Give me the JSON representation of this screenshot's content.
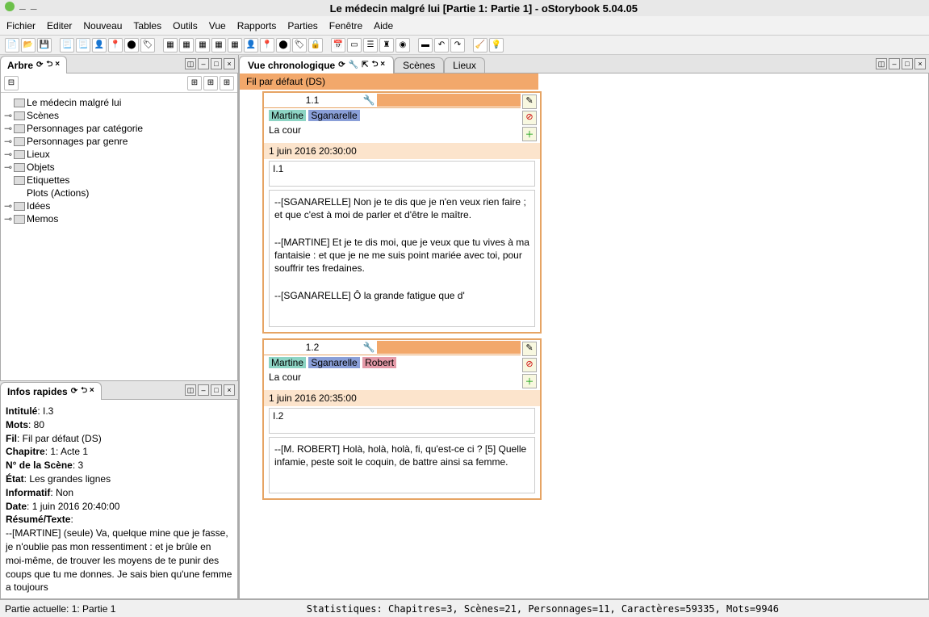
{
  "window": {
    "title": "Le médecin malgré lui [Partie 1: Partie 1] - oStorybook 5.04.05"
  },
  "menu": {
    "fichier": "Fichier",
    "editer": "Editer",
    "nouveau": "Nouveau",
    "tables": "Tables",
    "outils": "Outils",
    "vue": "Vue",
    "rapports": "Rapports",
    "parties": "Parties",
    "fenetre": "Fenêtre",
    "aide": "Aide"
  },
  "tree_panel": {
    "title": "Arbre",
    "root": "Le médecin malgré lui",
    "items": [
      "Scènes",
      "Personnages par catégorie",
      "Personnages par genre",
      "Lieux",
      "Objets",
      "Etiquettes",
      "Plots (Actions)",
      "Idées",
      "Memos"
    ]
  },
  "info_panel": {
    "title": "Infos rapides",
    "intitule_label": "Intitulé",
    "intitule": "I.3",
    "mots_label": "Mots",
    "mots": "80",
    "fil_label": "Fil",
    "fil": "Fil par défaut (DS)",
    "chapitre_label": "Chapitre",
    "chapitre": "1: Acte 1",
    "num_label": "N° de la Scène",
    "num": "3",
    "etat_label": "État",
    "etat": "Les grandes lignes",
    "informatif_label": "Informatif",
    "informatif": "Non",
    "date_label": "Date",
    "date": "1 juin 2016 20:40:00",
    "resume_label": "Résumé/Texte",
    "resume": "--[MARTINE] (seule) Va, quelque mine que je fasse, je n'oublie pas mon ressentiment : et je brûle en moi-même, de trouver les moyens de te punir des coups que tu me donnes. Je sais bien qu'une femme a toujours"
  },
  "chrono": {
    "title": "Vue chronologique",
    "tab_scenes": "Scènes",
    "tab_lieux": "Lieux",
    "strand": "Fil par défaut (DS)",
    "scene1": {
      "num": "1.1",
      "chars": {
        "martine": "Martine",
        "sgan": "Sganarelle"
      },
      "loc": "La cour",
      "date": "1 juin 2016 20:30:00",
      "id": "I.1",
      "text_p1": "--[SGANARELLE] Non je te dis que je n'en veux rien faire ; et que c'est à moi de parler et d'être le maître.",
      "text_p2": "--[MARTINE] Et je te dis moi, que je veux que tu vives à ma fantaisie : et que je ne me suis point mariée avec toi, pour souffrir tes fredaines.",
      "text_p3": "--[SGANARELLE] Ô la grande fatigue que d'"
    },
    "scene2": {
      "num": "1.2",
      "chars": {
        "martine": "Martine",
        "sgan": "Sganarelle",
        "robert": "Robert"
      },
      "loc": "La cour",
      "date": "1 juin 2016 20:35:00",
      "id": "I.2",
      "text_p1": "--[M. ROBERT] Holà, holà, holà, fi, qu'est-ce ci ? [5] Quelle infamie, peste soit le coquin, de battre ainsi sa femme."
    }
  },
  "status": {
    "left": "Partie actuelle: 1: Partie 1",
    "right": "Statistiques: Chapitres=3, Scènes=21, Personnages=11, Caractères=59335, Mots=9946"
  }
}
